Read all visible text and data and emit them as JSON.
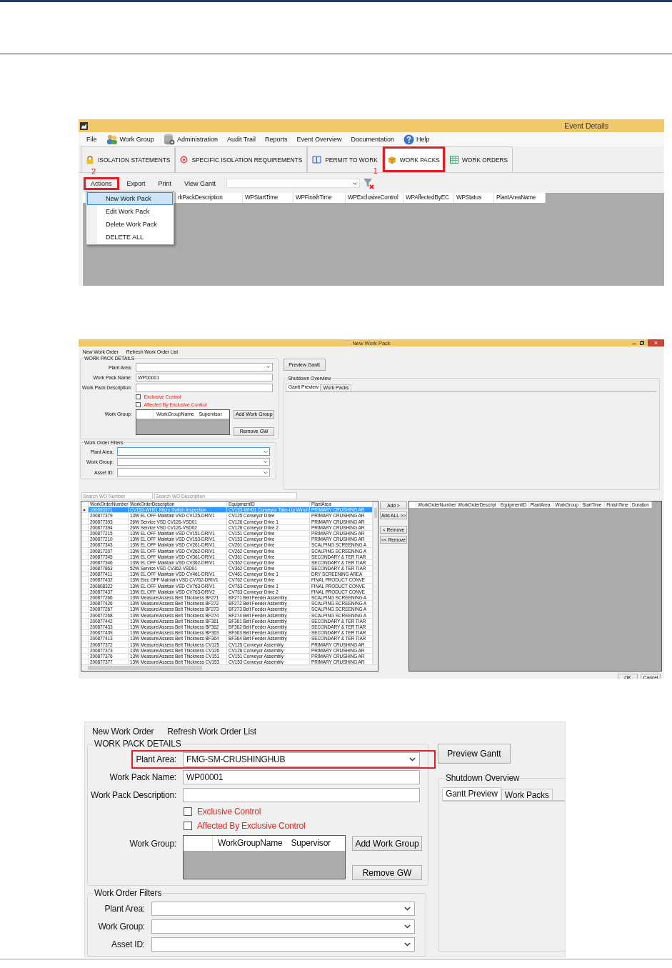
{
  "event_details": {
    "title": "Event Details",
    "menu": [
      {
        "label": "File"
      },
      {
        "label": "Work Group"
      },
      {
        "label": "Administration"
      },
      {
        "label": "Audit Trail"
      },
      {
        "label": "Reports"
      },
      {
        "label": "Event Overview"
      },
      {
        "label": "Documentation"
      },
      {
        "label": "Help"
      }
    ],
    "tabs": [
      {
        "label": "ISOLATION STATEMENTS",
        "selected": false,
        "marked": false
      },
      {
        "label": "SPECIFIC ISOLATION REQUIREMENTS",
        "selected": false,
        "marked": false
      },
      {
        "label": "PERMIT TO WORK",
        "selected": false,
        "marked": false
      },
      {
        "label": "WORK PACKS",
        "selected": true,
        "marked": true,
        "callout": "1"
      },
      {
        "label": "WORK ORDERS",
        "selected": false,
        "marked": false
      }
    ],
    "toolbar": [
      {
        "label": "Actions",
        "marked": true,
        "callout": "2"
      },
      {
        "label": "Export",
        "marked": false
      },
      {
        "label": "Print",
        "marked": false
      },
      {
        "label": "View Gantt",
        "marked": false
      }
    ],
    "actions_menu": [
      {
        "label": "New Work Pack",
        "selected": true
      },
      {
        "label": "Edit Work Pack",
        "selected": false
      },
      {
        "label": "Delete Work Pack",
        "selected": false
      },
      {
        "label": "DELETE ALL",
        "selected": false
      }
    ],
    "columns": [
      "rkPackDescription",
      "WPStartTime",
      "WPFinishTime",
      "WPExclusiveControl",
      "WPAffectedByEC",
      "WPStatus",
      "PlantAreaName"
    ]
  },
  "new_work_pack": {
    "title": "New Work Pack",
    "upper": {
      "menu": [
        "New Work Order",
        "Refresh Work Order List"
      ],
      "details": {
        "title": "WORK PACK DETAILS",
        "plant_area": {
          "label": "Plant Area:",
          "marked": false
        },
        "work_pack_name": {
          "label": "Work Pack Name:",
          "value": "WP00001"
        },
        "description": {
          "label": "Work Pack Description:"
        },
        "checkboxes": [
          {
            "label": "Exclusive Control",
            "checked": false
          },
          {
            "label": "Affected By Exclusive Control",
            "checked": false
          }
        ],
        "work_group": {
          "label": "Work Group:",
          "columns": [
            "WorkGroupName",
            "Supervisor"
          ]
        },
        "buttons": [
          "Add Work Group",
          "Remove GW"
        ]
      },
      "preview_button": "Preview Gantt",
      "overview": {
        "title": "Shutdown Overview",
        "tabs": [
          {
            "label": "Gantt Preview",
            "selected": true
          },
          {
            "label": "Work Packs",
            "selected": false
          }
        ]
      },
      "filters": {
        "title": "Work Order Filters",
        "fields": [
          {
            "label": "Plant Area:",
            "focused": true
          },
          {
            "label": "Work Group:",
            "focused": false
          },
          {
            "label": "Asset ID:",
            "focused": false
          }
        ]
      }
    },
    "search_fields": [
      {
        "placeholder": "Search WO Number"
      },
      {
        "placeholder": "Search WO Description"
      }
    ],
    "work_orders": {
      "columns": [
        "WorkOrderNumber",
        "WorkOrderDescription",
        "EquipmentID",
        "PlantArea"
      ],
      "rows": [
        {
          "cells": [
            "100693371",
            "CV153-WH01 Micro Switch Inspection",
            "CV153-WH01 Conveyor Take-Up Winch",
            "PRIMARY CRUSHING AR"
          ],
          "selected": true
        },
        {
          "cells": [
            "200877379",
            "13W EL OFF Maintain VSD CV125-DRIV1",
            "CV125 Conveyor Drive",
            "PRIMARY CRUSHING AR"
          ],
          "selected": false
        },
        {
          "cells": [
            "200877393",
            "26W Service VSD CV126-VSD01",
            "CV126 Conveyor Drive 1",
            "PRIMARY CRUSHING AR"
          ],
          "selected": false
        },
        {
          "cells": [
            "200877394",
            "26W Service VSD CV126-VSD02",
            "CV126 Conveyor Drive 2",
            "PRIMARY CRUSHING AR"
          ],
          "selected": false
        },
        {
          "cells": [
            "200877215",
            "13W EL OFF Maintain VSD CV151-DRIV1",
            "CV151 Conveyor Drive",
            "PRIMARY CRUSHING AR"
          ],
          "selected": false
        },
        {
          "cells": [
            "200877210",
            "13W EL OFF Maintain VSD CV153-DRIV1",
            "CV153 Conveyor Drive",
            "PRIMARY CRUSHING AR"
          ],
          "selected": false
        },
        {
          "cells": [
            "200877343",
            "13W EL OFF Maintain VSD CV261-DRIV1",
            "CV261 Conveyor Drive",
            "SCALPING SCREENING A"
          ],
          "selected": false
        },
        {
          "cells": [
            "200817207",
            "13W EL OFF Maintain VSD CV262-DRIV1",
            "CV262 Conveyor Drive",
            "SCALPING SCREENING A"
          ],
          "selected": false
        },
        {
          "cells": [
            "200877345",
            "13W EL OFF Maintain VSD CV361-DRIV1",
            "CV361 Conveyor Drive",
            "SECONDARY & TER TIAR"
          ],
          "selected": false
        },
        {
          "cells": [
            "200877346",
            "13W EL OFF Maintain VSD CV362-DRIV1",
            "CV362 Conveyor Drive",
            "SECONDARY & TER TIAR"
          ],
          "selected": false
        },
        {
          "cells": [
            "200877863",
            "52W Service VSD CV362-VSD01",
            "CV362 Conveyor Drive",
            "SECONDARY & TER TIAR"
          ],
          "selected": false
        },
        {
          "cells": [
            "200877411",
            "13W EL OFF Maintain VSD CV461-DRIV1",
            "CV461 Conveyor Drive 1",
            "DRY SCREENING AREA"
          ],
          "selected": false
        },
        {
          "cells": [
            "200877432",
            "13W Elec OFF Maintain VSD CV762-DRIV1",
            "CV762 Conveyor Drive",
            "FINAL PRODUCT CONVE"
          ],
          "selected": false
        },
        {
          "cells": [
            "200808322",
            "13W EL OFF Maintain VSD CV763-DRIV1",
            "CV763 Conveyor Drive 1",
            "FINAL PRODUCT CONVE"
          ],
          "selected": false
        },
        {
          "cells": [
            "200877437",
            "13W EL OFF Maintain VSD CV763-DRIV2",
            "CV763 Conveyor Drive 2",
            "FINAL PRODUCT CONVE"
          ],
          "selected": false
        },
        {
          "cells": [
            "200877266",
            "13W Measure/Assess Belt Thickness BF271",
            "BF271 Belt Feeder Assembly",
            "SCALPING SCREENING A"
          ],
          "selected": false
        },
        {
          "cells": [
            "200877426",
            "13W Measure/Assess Belt Thickness BF272",
            "BF272 Belt Feeder Assembly",
            "SCALPING SCREENING A"
          ],
          "selected": false
        },
        {
          "cells": [
            "200877267",
            "13W Measure/Assess Belt Thickness BF273",
            "BF273 Belt Feeder Assembly",
            "SCALPING SCREENING A"
          ],
          "selected": false
        },
        {
          "cells": [
            "200877268",
            "13W Measure/Assess Belt Thickness BF274",
            "BF274 Belt Feeder Assembly",
            "SCALPING SCREENING A"
          ],
          "selected": false
        },
        {
          "cells": [
            "200877442",
            "13W Measure/Assess Belt Thickness BF361",
            "BF361 Belt Feeder Assembly",
            "SECONDARY & TER TIAR"
          ],
          "selected": false
        },
        {
          "cells": [
            "200877433",
            "13W Measure/Assess Belt Thickness BF362",
            "BF362 Belt Feeder Assembly",
            "SECONDARY & TER TIAR"
          ],
          "selected": false
        },
        {
          "cells": [
            "200877439",
            "13W Measure/Assess Belt Thickness BF363",
            "BF363 Belt Feeder Assembly",
            "SECONDARY & TER TIAR"
          ],
          "selected": false
        },
        {
          "cells": [
            "200877413",
            "13W Measure/Assess Belt Thickness BF364",
            "BF364 Belt Feeder Assembly",
            "SECONDARY & TER TIAR"
          ],
          "selected": false
        },
        {
          "cells": [
            "200877372",
            "13W Measure/Assess Belt Thickness CV125",
            "CV125 Conveyor Assembly",
            "PRIMARY CRUSHING AR"
          ],
          "selected": false
        },
        {
          "cells": [
            "200877373",
            "13W Measure/Assess Belt Thickness CV126",
            "CV126 Conveyor Assembly",
            "PRIMARY CRUSHING AR"
          ],
          "selected": false
        },
        {
          "cells": [
            "200877376",
            "13W Measure/Assess Belt Thickness CV151",
            "CV151 Conveyor Assembly",
            "PRIMARY CRUSHING AR"
          ],
          "selected": false
        },
        {
          "cells": [
            "200877377",
            "13W Measure/Assess Belt Thickness CV153",
            "CV153 Conveyor Assembly",
            "PRIMARY CRUSHING AR"
          ],
          "selected": false
        }
      ]
    },
    "transfer_buttons": [
      "Add >",
      "Add ALL >>",
      "< Remove",
      "<< Remove"
    ],
    "selected_orders": {
      "columns": [
        "WorkOrderNumber",
        "WorkOrderDescript",
        "EquipmentID",
        "PlantArea",
        "WorkGroup",
        "StartTime",
        "FinishTime",
        "Duration"
      ]
    },
    "dialog_buttons": [
      "OK",
      "Cancel"
    ]
  },
  "detail_crop": {
    "menu": [
      "New Work Order",
      "Refresh Work Order List"
    ],
    "details": {
      "title": "WORK PACK DETAILS",
      "plant_area": {
        "label": "Plant Area:",
        "value": "FMG-SM-CRUSHINGHUB",
        "marked": true
      },
      "work_pack_name": {
        "label": "Work Pack Name:",
        "value": "WP00001"
      },
      "description": {
        "label": "Work Pack Description:"
      },
      "checkboxes": [
        {
          "label": "Exclusive Control",
          "checked": false
        },
        {
          "label": "Affected By Exclusive Control",
          "checked": false
        }
      ],
      "work_group": {
        "label": "Work Group:",
        "columns": [
          "WorkGroupName",
          "Supervisor"
        ]
      },
      "buttons": [
        "Add Work Group",
        "Remove GW"
      ]
    },
    "preview_button": "Preview Gantt",
    "overview": {
      "title": "Shutdown Overview",
      "tabs": [
        {
          "label": "Gantt Preview",
          "selected": true
        },
        {
          "label": "Work Packs",
          "selected": false
        }
      ]
    },
    "filters": {
      "title": "Work Order Filters",
      "fields": [
        {
          "label": "Plant Area:",
          "focused": false
        },
        {
          "label": "Work Group:",
          "focused": false
        },
        {
          "label": "Asset ID:",
          "focused": false
        }
      ]
    }
  }
}
